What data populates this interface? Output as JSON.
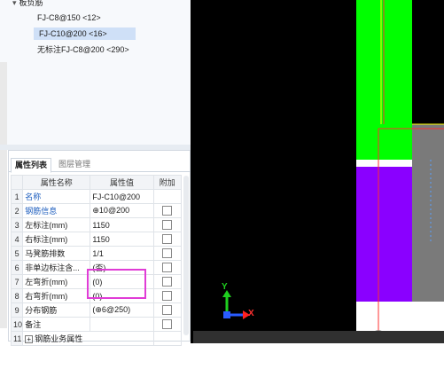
{
  "tree": {
    "group_label": "板负筋",
    "items": [
      {
        "label": "FJ-C8@150 <12>",
        "selected": false
      },
      {
        "label": "FJ-C10@200 <16>",
        "selected": true
      },
      {
        "label": "无标注FJ-C8@200 <290>",
        "selected": false
      }
    ]
  },
  "props": {
    "close_glyph": "×",
    "tabs": [
      {
        "label": "属性列表"
      },
      {
        "label": "图层管理"
      }
    ],
    "headers": {
      "name": "属性名称",
      "value": "属性值",
      "extra": "附加"
    },
    "rows": [
      {
        "n": "1",
        "name": "名称",
        "value": "FJ-C10@200",
        "check": false
      },
      {
        "n": "2",
        "name": "钢筋信息",
        "value": "⊕10@200",
        "check": true
      },
      {
        "n": "3",
        "name": "左标注(mm)",
        "value": "1150",
        "check": true
      },
      {
        "n": "4",
        "name": "右标注(mm)",
        "value": "1150",
        "check": true
      },
      {
        "n": "5",
        "name": "马凳筋排数",
        "value": "1/1",
        "check": true
      },
      {
        "n": "6",
        "name": "非单边标注含...",
        "value": "(否)",
        "check": true
      },
      {
        "n": "7",
        "name": "左弯折(mm)",
        "value": "(0)",
        "check": true
      },
      {
        "n": "8",
        "name": "右弯折(mm)",
        "value": "(0)",
        "check": true
      },
      {
        "n": "9",
        "name": "分布钢筋",
        "value": "(⊕6@250)",
        "check": true
      },
      {
        "n": "10",
        "name": "备注",
        "value": "",
        "check": true
      },
      {
        "n": "11",
        "name": "钢筋业务属性",
        "value": "",
        "check": false
      }
    ]
  },
  "viewport": {
    "axis_y": "Y",
    "axis_x": "X"
  },
  "colors": {
    "green": "#00ff00",
    "purple": "#8a00ff",
    "gray": "#7a7a7a",
    "highlight": "#e03cd6",
    "link": "#1f5fbf"
  }
}
